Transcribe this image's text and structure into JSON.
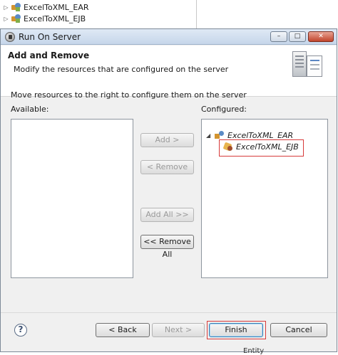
{
  "background": {
    "project_tree": [
      {
        "label": "ExcelToXML_EAR"
      },
      {
        "label": "ExcelToXML_EJB"
      }
    ],
    "bottom_text_left": "",
    "bottom_text_right": "Entity"
  },
  "dialog": {
    "title": "Run On Server",
    "window_controls": {
      "minimize": "–",
      "maximize": "□",
      "close": "✕"
    },
    "header": {
      "title": "Add and Remove",
      "subtitle": "Modify the resources that are configured on the server"
    },
    "instruction": "Move resources to the right to configure them on the server",
    "available": {
      "label": "Available:",
      "items": []
    },
    "configured": {
      "label": "Configured:",
      "parent": "ExcelToXML_EAR",
      "child": "ExcelToXML_EJB"
    },
    "buttons": {
      "add": "Add >",
      "remove": "< Remove",
      "add_all": "Add All >>",
      "remove_all": "<< Remove All",
      "help": "?",
      "back": "< Back",
      "next": "Next >",
      "finish": "Finish",
      "cancel": "Cancel"
    },
    "colors": {
      "highlight": "#d73a3a",
      "focus": "#3c7fb1"
    }
  }
}
